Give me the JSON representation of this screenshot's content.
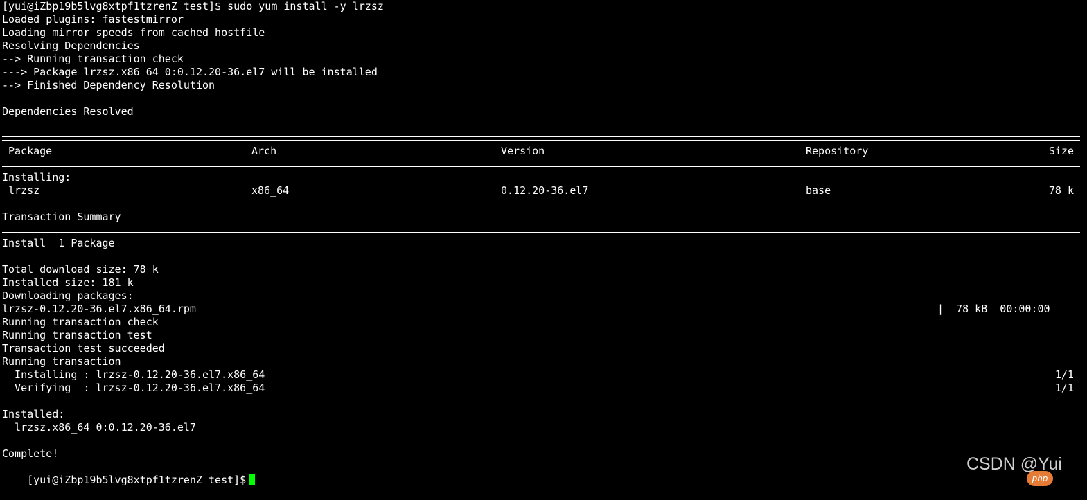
{
  "prompt_cmd": "[yui@iZbp19b5lvg8xtpf1tzrenZ test]$ sudo yum install -y lrzsz",
  "pre_lines": [
    "Loaded plugins: fastestmirror",
    "Loading mirror speeds from cached hostfile",
    "Resolving Dependencies",
    "--> Running transaction check",
    "---> Package lrzsz.x86_64 0:0.12.20-36.el7 will be installed",
    "--> Finished Dependency Resolution",
    "",
    "Dependencies Resolved"
  ],
  "table": {
    "headers": {
      "package": "Package",
      "arch": "Arch",
      "version": "Version",
      "repository": "Repository",
      "size": "Size"
    },
    "section": "Installing:",
    "row": {
      "package": "lrzsz",
      "arch": "x86_64",
      "version": "0.12.20-36.el7",
      "repository": "base",
      "size": "78 k"
    }
  },
  "summary": {
    "title": "Transaction Summary",
    "install": "Install  1 Package",
    "total_download": "Total download size: 78 k",
    "installed_size": "Installed size: 181 k",
    "downloading": "Downloading packages:",
    "rpm_name": "lrzsz-0.12.20-36.el7.x86_64.rpm",
    "rpm_progress": "|  78 kB  00:00:00"
  },
  "post_lines": [
    "Running transaction check",
    "Running transaction test",
    "Transaction test succeeded",
    "Running transaction"
  ],
  "steps": [
    {
      "text": "  Installing : lrzsz-0.12.20-36.el7.x86_64",
      "count": "1/1"
    },
    {
      "text": "  Verifying  : lrzsz-0.12.20-36.el7.x86_64",
      "count": "1/1"
    }
  ],
  "installed_label": "Installed:",
  "installed_pkg": "  lrzsz.x86_64 0:0.12.20-36.el7",
  "complete": "Complete!",
  "final_prompt": "[yui@iZbp19b5lvg8xtpf1tzrenZ test]$",
  "cursor_color": "#00ff00",
  "watermark": "CSDN @Yui",
  "badge": "php"
}
